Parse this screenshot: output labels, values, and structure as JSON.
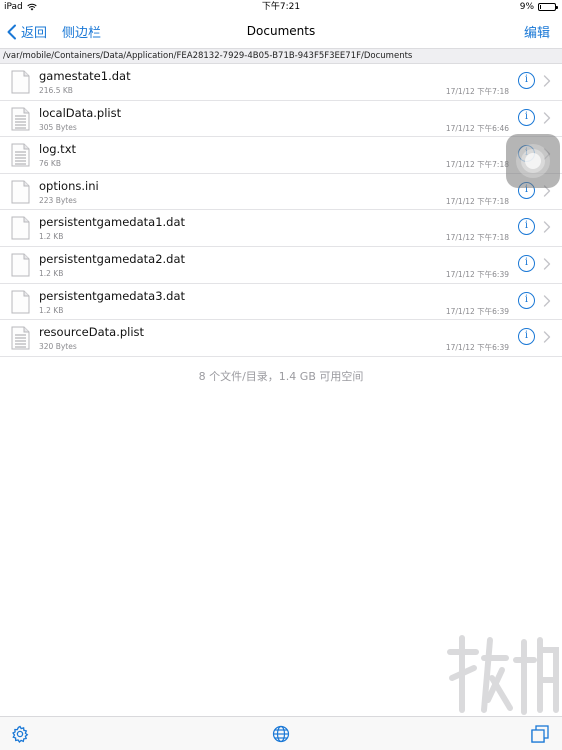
{
  "status_bar": {
    "device": "iPad",
    "time": "下午7:21",
    "battery": "9%",
    "battery_level": 0.09
  },
  "nav": {
    "back_label": "返回",
    "sidebar_label": "侧边栏",
    "title": "Documents",
    "edit_label": "编辑"
  },
  "path": "/var/mobile/Containers/Data/Application/FEA28132-7929-4B05-B71B-943F5F3EE71F/Documents",
  "files": [
    {
      "name": "gamestate1.dat",
      "size": "216.5 KB",
      "date": "17/1/12 下午7:18",
      "icon": "file-icon"
    },
    {
      "name": "localData.plist",
      "size": "305 Bytes",
      "date": "17/1/12 下午6:46",
      "icon": "text-file-icon"
    },
    {
      "name": "log.txt",
      "size": "76 KB",
      "date": "17/1/12 下午7:18",
      "icon": "text-file-icon"
    },
    {
      "name": "options.ini",
      "size": "223 Bytes",
      "date": "17/1/12 下午7:18",
      "icon": "file-icon"
    },
    {
      "name": "persistentgamedata1.dat",
      "size": "1.2 KB",
      "date": "17/1/12 下午7:18",
      "icon": "file-icon"
    },
    {
      "name": "persistentgamedata2.dat",
      "size": "1.2 KB",
      "date": "17/1/12 下午6:39",
      "icon": "file-icon"
    },
    {
      "name": "persistentgamedata3.dat",
      "size": "1.2 KB",
      "date": "17/1/12 下午6:39",
      "icon": "file-icon"
    },
    {
      "name": "resourceData.plist",
      "size": "320 Bytes",
      "date": "17/1/12 下午6:39",
      "icon": "text-file-icon"
    }
  ],
  "summary": "8 个文件/目录，1.4 GB 可用空间",
  "toolbar": {
    "left_icon": "gear-icon",
    "center_icon": "globe-icon",
    "right_icon": "windows-icon"
  },
  "colors": {
    "accent": "#1a78d6",
    "secondary_text": "#8a8a8e",
    "separator": "#e3e3e6"
  }
}
